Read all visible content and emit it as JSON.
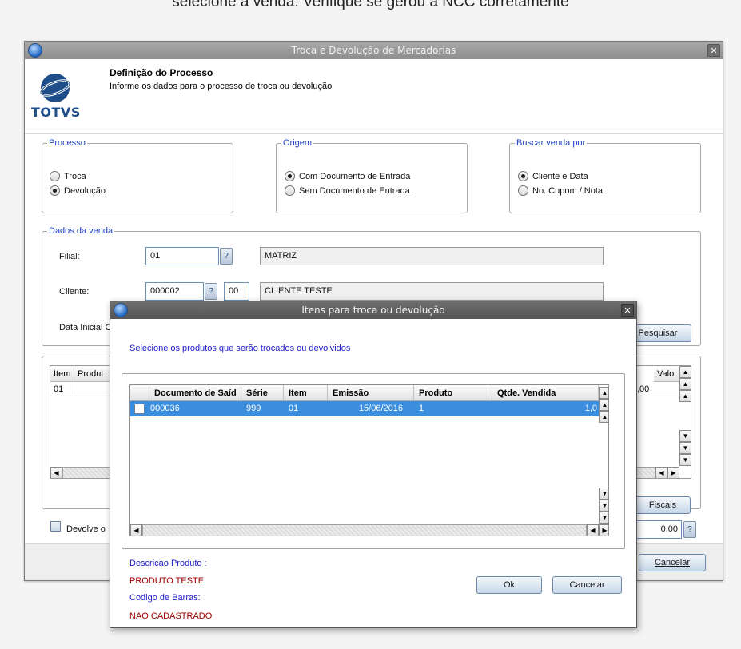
{
  "caption": "selecione a venda. Verifique se gerou a NCC corretamente",
  "main_window": {
    "title": "Troca e Devolução de Mercadorias",
    "close": "✕",
    "header_title": "Definição do Processo",
    "header_subtitle": "Informe os dados para o processo de troca ou devolução",
    "logo_text": "TOTVS"
  },
  "processo": {
    "legend": "Processo",
    "options": [
      "Troca",
      "Devolução"
    ],
    "selected": "Devolução"
  },
  "origem": {
    "legend": "Origem",
    "options": [
      "Com Documento de Entrada",
      "Sem Documento de Entrada"
    ],
    "selected": "Com Documento de Entrada"
  },
  "buscar": {
    "legend": "Buscar venda por",
    "options": [
      "Cliente e Data",
      "No. Cupom / Nota"
    ],
    "selected": "Cliente e Data"
  },
  "dados_venda": {
    "legend": "Dados da venda",
    "filial_label": "Filial:",
    "filial_code": "01",
    "filial_name": "MATRIZ",
    "cliente_label": "Cliente:",
    "cliente_code": "000002",
    "cliente_loja": "00",
    "cliente_name": "CLIENTE TESTE",
    "data_label": "Data Inicial C",
    "pesquisar": "Pesquisar",
    "qmark": "?"
  },
  "back_grid": {
    "headers": [
      "Item",
      "Produt",
      "Valo"
    ],
    "row_item": "01",
    "row_valor": ",00"
  },
  "fiscais_button": "Fiscais",
  "devolve_label": "Devolve o",
  "total_value": "0,00",
  "cancelar_main": "Cancelar",
  "dialog": {
    "title": "Itens para troca ou devolução",
    "close": "✕",
    "prompt": "Selecione os produtos que serão trocados ou devolvidos",
    "columns": [
      "Documento de Saíd",
      "Série",
      "Item",
      "Emissão",
      "Produto",
      "Qtde. Vendida"
    ],
    "row": {
      "documento": "000036",
      "serie": "999",
      "item": "01",
      "emissao": "15/06/2016",
      "produto": "1",
      "qtde": "1,0"
    },
    "descricao_label": "Descricao Produto :",
    "descricao_value": "PRODUTO TESTE",
    "codigo_label": "Codigo de Barras:",
    "codigo_value": "NAO CADASTRADO",
    "ok": "Ok",
    "cancelar": "Cancelar"
  }
}
